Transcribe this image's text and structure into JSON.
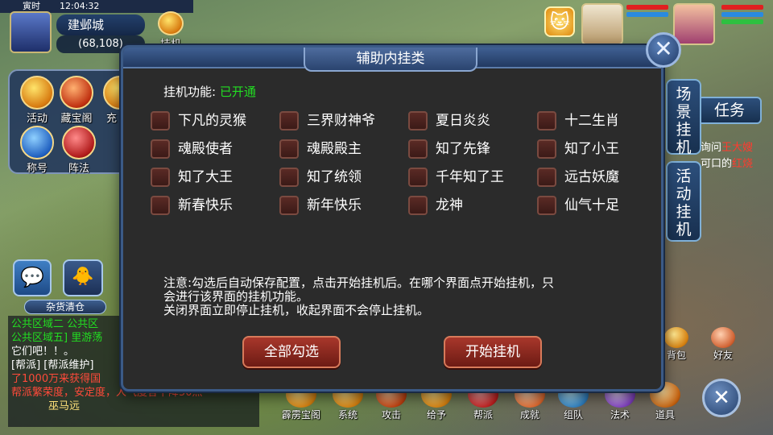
{
  "status_bar": {
    "label": "寅时",
    "time": "12:04:32"
  },
  "map": {
    "name": "建邺城",
    "coords": "(68,108)"
  },
  "top_buttons": {
    "auto_play": "挂机"
  },
  "left_menu": {
    "items": [
      {
        "label": "活动"
      },
      {
        "label": "藏宝阁"
      },
      {
        "label": "充"
      },
      {
        "label": "称号"
      },
      {
        "label": "阵法"
      }
    ]
  },
  "left_misc": {
    "shop": "杂货清仓"
  },
  "chat": {
    "lines": [
      "公共区域二  公共区",
      "公共区域五] 里游荡",
      "它们吧！！。",
      "[帮派] [帮派维护]",
      "了1000万来获得国",
      "帮派繁荣度，安定度，人气度各下降50点"
    ],
    "footer": "巫马远"
  },
  "quest": {
    "title": "任务",
    "line1": "询问王大嫂",
    "line2": "可口的红烧",
    "highlight1": "王大嫂",
    "highlight2": "红烧"
  },
  "side_tabs": {
    "scene": "场景挂机",
    "activity": "活动挂机"
  },
  "dialog": {
    "title": "辅助内挂类",
    "status_label": "挂机功能:",
    "status_value": "已开通",
    "options": [
      [
        "下凡的灵猴",
        "三界财神爷",
        "夏日炎炎",
        "十二生肖"
      ],
      [
        "魂殿使者",
        "魂殿殿主",
        "知了先锋",
        "知了小王"
      ],
      [
        "知了大王",
        "知了统领",
        "千年知了王",
        "远古妖魔"
      ],
      [
        "新春快乐",
        "新年快乐",
        "龙神",
        "仙气十足"
      ]
    ],
    "note_lines": [
      "注意:勾选后自动保存配置，点击开始挂机后。在哪个界面点开始挂机，只",
      "会进行该界面的挂机功能。",
      "关闭界面立即停止挂机，收起界面不会停止挂机。"
    ],
    "select_all": "全部勾选",
    "start": "开始挂机",
    "close_symbol": "✕"
  },
  "bottom_bar": {
    "items": [
      "霹雳宝阁",
      "系统",
      "攻击",
      "给予",
      "帮派",
      "成就",
      "组队",
      "法术",
      "道具"
    ]
  },
  "right_bottom": {
    "bag": "背包",
    "friends": "好友",
    "collapse": "✕"
  },
  "colors": {
    "status_green": "#22dd22",
    "highlight_red": "#ff3b2f"
  }
}
